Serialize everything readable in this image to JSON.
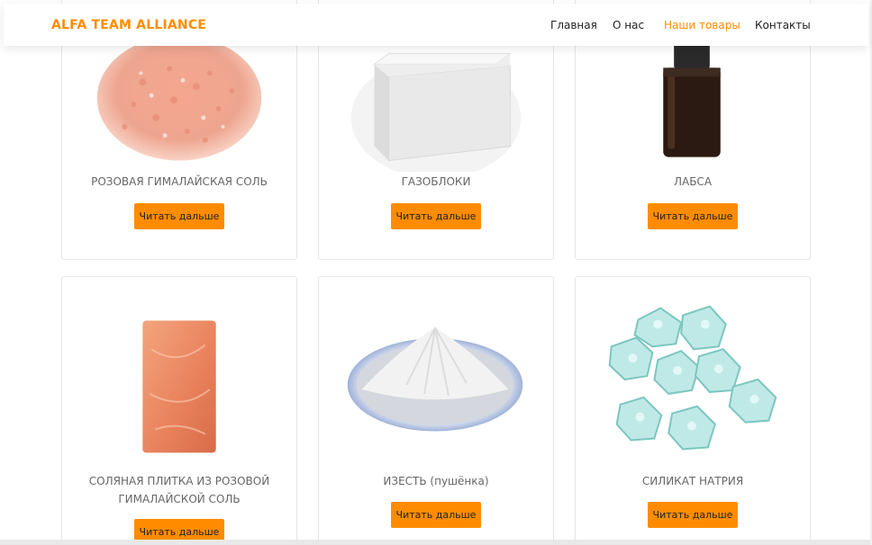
{
  "brand": {
    "name": "ALFA TEAM ALLIANCE",
    "color": "#ff8c00"
  },
  "nav": {
    "items": [
      {
        "label": "Главная",
        "active": false
      },
      {
        "label": "О нас",
        "active": false
      },
      {
        "label": "Наши товары",
        "active": true
      },
      {
        "label": "Контакты",
        "active": false
      }
    ]
  },
  "products": [
    {
      "title": "РОЗОВАЯ ГИМАЛАЙСКАЯ СОЛЬ",
      "image": "pink-salt-crystals",
      "button": "Читать дальше"
    },
    {
      "title": "ГАЗОБЛОКИ",
      "image": "aerated-concrete-block",
      "button": "Читать дальше"
    },
    {
      "title": "ЛАБСА",
      "image": "labsa-bottle",
      "button": "Читать дальше"
    },
    {
      "title": "СОЛЯНАЯ ПЛИТКА ИЗ РОЗОВОЙ ГИМАЛАЙСКОЙ СОЛЬ",
      "image": "salt-tile",
      "button": "Читать дальше"
    },
    {
      "title": "ИЗЕСТЬ (пушёнка)",
      "image": "lime-powder",
      "button": "Читать дальше"
    },
    {
      "title": "СИЛИКАТ НАТРИЯ",
      "image": "sodium-silicate-crystals",
      "button": "Читать дальше"
    }
  ]
}
